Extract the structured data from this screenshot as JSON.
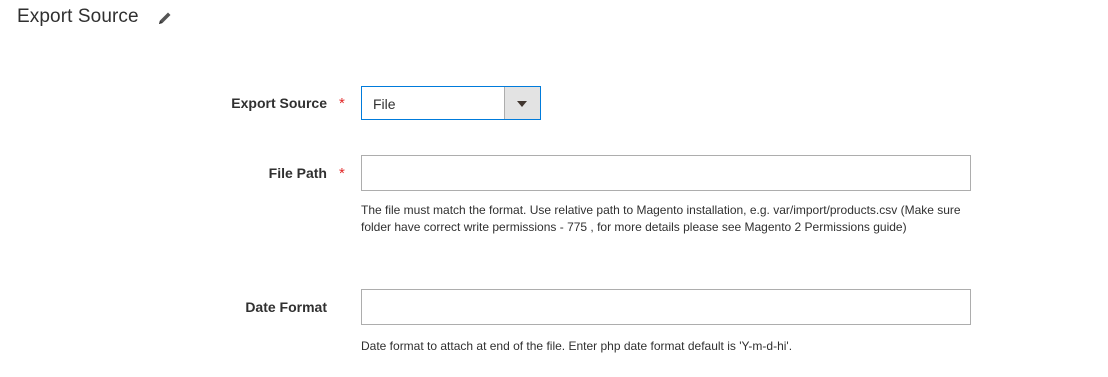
{
  "section": {
    "title": "Export Source"
  },
  "fields": {
    "export_source": {
      "label": "Export Source",
      "required_mark": "*",
      "value": "File"
    },
    "file_path": {
      "label": "File Path",
      "required_mark": "*",
      "value": "",
      "note": "The file must match the format. Use relative path to Magento installation, e.g. var/import/products.csv (Make sure folder have correct write permissions - 775 , for more details please see Magento 2 Permissions guide)"
    },
    "date_format": {
      "label": "Date Format",
      "value": "",
      "note": "Date format to attach at end of the file. Enter php date format default is 'Y-m-d-hi'."
    }
  },
  "colors": {
    "required": "#e22626",
    "focus_border": "#007bdb",
    "input_border": "#adadad",
    "text": "#303030"
  },
  "icons": {
    "edit": "pencil-icon",
    "dropdown": "triangle-down-icon"
  }
}
